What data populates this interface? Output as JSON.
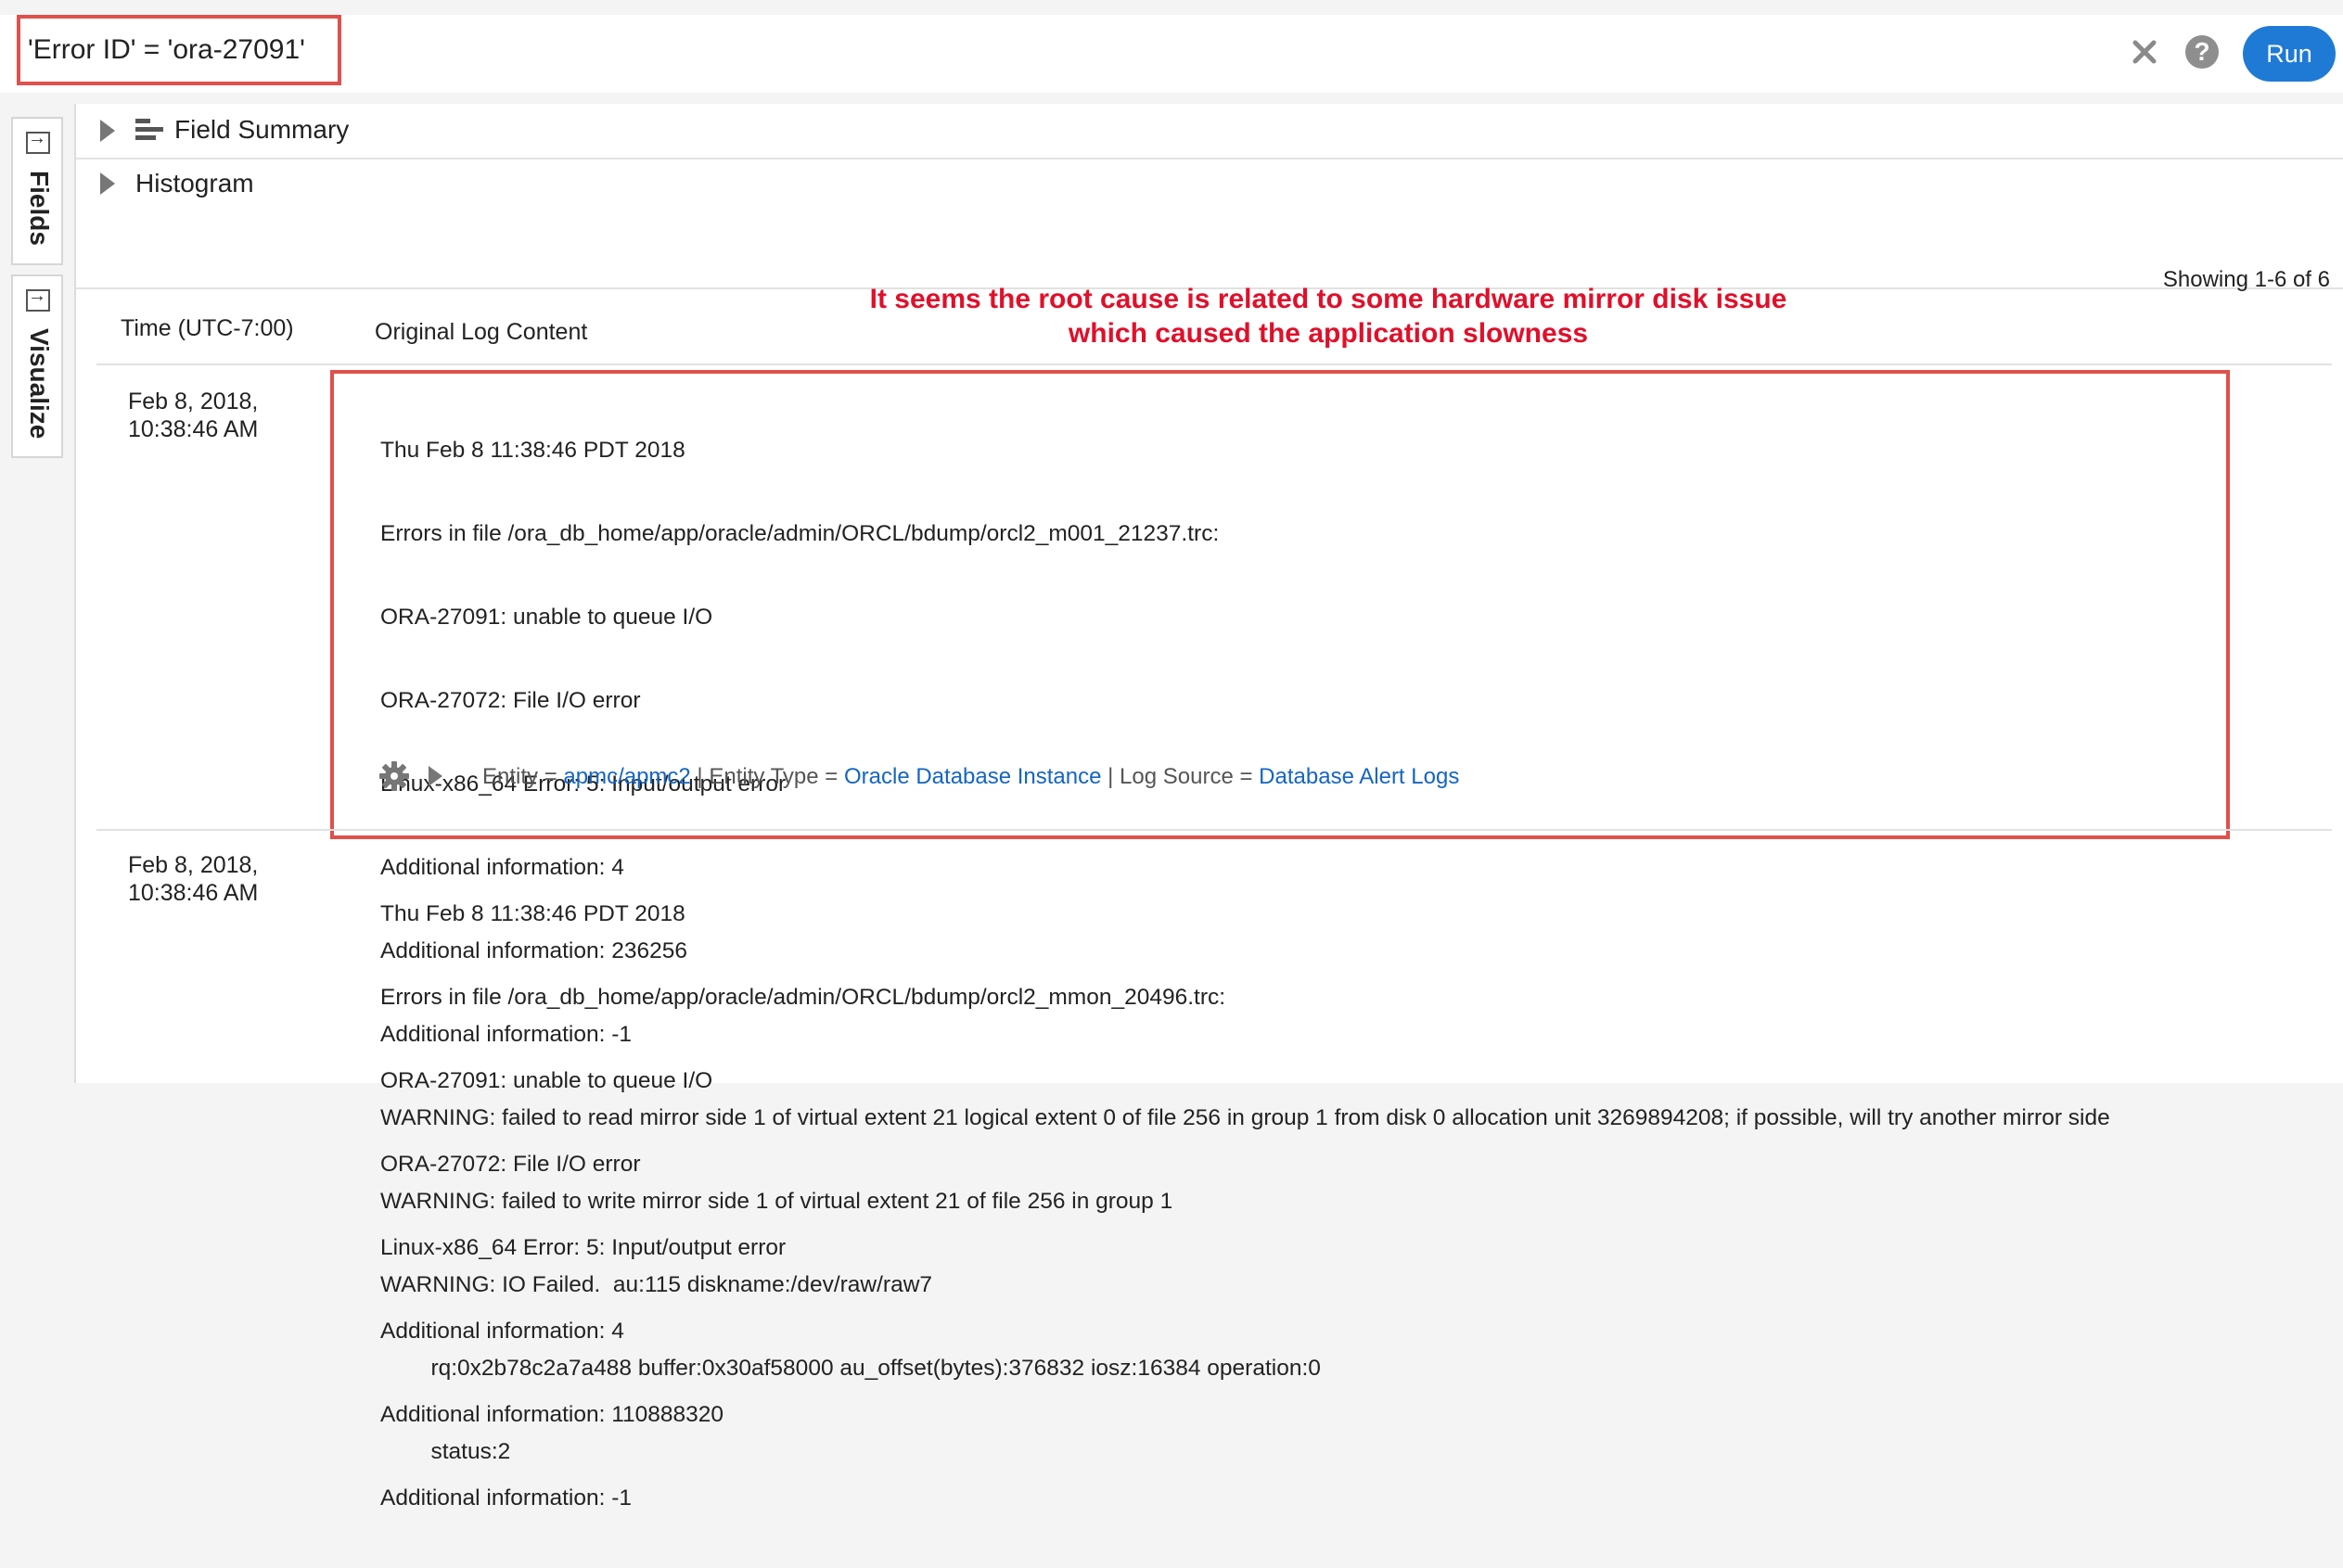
{
  "query": {
    "value": "'Error ID' = 'ora-27091'"
  },
  "toolbar": {
    "run_label": "Run",
    "help_label": "?"
  },
  "side_tabs": [
    {
      "label": "Fields"
    },
    {
      "label": "Visualize"
    }
  ],
  "sections": {
    "field_summary": "Field Summary",
    "histogram": "Histogram"
  },
  "results": {
    "showing": "Showing 1-6 of 6",
    "columns": {
      "time": "Time (UTC-7:00)",
      "content": "Original Log Content"
    }
  },
  "annotation": {
    "line1": "It seems the root cause is related to some hardware mirror disk issue",
    "line2": "which caused the application slowness"
  },
  "rows": [
    {
      "time_line1": "Feb 8, 2018,",
      "time_line2": "10:38:46 AM",
      "lines": [
        "Thu Feb 8 11:38:46 PDT 2018",
        "Errors in file /ora_db_home/app/oracle/admin/ORCL/bdump/orcl2_m001_21237.trc:",
        "ORA-27091: unable to queue I/O",
        "ORA-27072: File I/O error",
        "Linux-x86_64 Error: 5: Input/output error",
        "Additional information: 4",
        "Additional information: 236256",
        "Additional information: -1",
        "WARNING: failed to read mirror side 1 of virtual extent 21 logical extent 0 of file 256 in group 1 from disk 0 allocation unit 3269894208; if possible, will try another mirror side",
        "WARNING: failed to write mirror side 1 of virtual extent 21 of file 256 in group 1",
        "WARNING: IO Failed.  au:115 diskname:/dev/raw/raw7",
        "        rq:0x2b78c2a7a488 buffer:0x30af58000 au_offset(bytes):376832 iosz:16384 operation:0",
        "        status:2"
      ],
      "meta": {
        "entity_label": "Entity = ",
        "entity": "apmc/apmc2",
        "entity_type_label": " | Entity Type = ",
        "entity_type": "Oracle Database Instance",
        "log_source_label": " | Log Source = ",
        "log_source": "Database Alert Logs"
      }
    },
    {
      "time_line1": "Feb 8, 2018,",
      "time_line2": "10:38:46 AM",
      "lines": [
        "Thu Feb 8 11:38:46 PDT 2018",
        "Errors in file /ora_db_home/app/oracle/admin/ORCL/bdump/orcl2_mmon_20496.trc:",
        "ORA-27091: unable to queue I/O",
        "ORA-27072: File I/O error",
        "Linux-x86_64 Error: 5: Input/output error",
        "Additional information: 4",
        "Additional information: 110888320",
        "Additional information: -1"
      ]
    }
  ]
}
